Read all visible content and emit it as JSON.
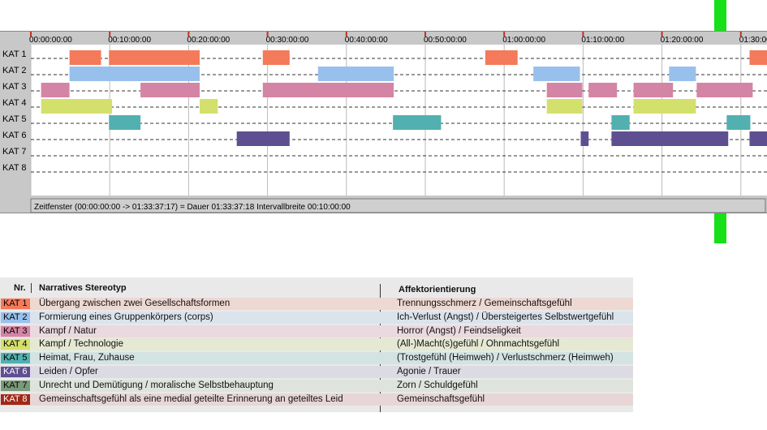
{
  "timeline": {
    "row_labels": [
      "KAT 1",
      "KAT 2",
      "KAT 3",
      "KAT 4",
      "KAT 5",
      "KAT 6",
      "KAT 7",
      "KAT 8"
    ],
    "tick_labels": [
      "00:00:00:00",
      "00:10:00:00",
      "00:20:00:00",
      "00:30:00:00",
      "00:40:00:00",
      "00:50:00:00",
      "01:00:00:00",
      "01:10:00:00",
      "01:20:00:00",
      "01:30:00"
    ],
    "status_text": "Zeitfenster (00:00:00:00 -> 01:33:37:17) = Dauer 01:33:37:18    Intervallbreite 00:10:00:00"
  },
  "chart_data": {
    "type": "timeline",
    "x_unit": "minutes",
    "xlim": [
      0,
      93.6
    ],
    "tick_interval_minutes": 10,
    "categories": [
      "KAT 1",
      "KAT 2",
      "KAT 3",
      "KAT 4",
      "KAT 5",
      "KAT 6",
      "KAT 7",
      "KAT 8"
    ],
    "colors": [
      "#f47a5a",
      "#98c0ec",
      "#d484a4",
      "#d4e06c",
      "#52b0b0",
      "#5e5090",
      "#7a9a7a",
      "#a02818"
    ],
    "segments": [
      {
        "cat": 0,
        "start": 4.9,
        "end": 8.9
      },
      {
        "cat": 0,
        "start": 9.9,
        "end": 21.4
      },
      {
        "cat": 0,
        "start": 29.4,
        "end": 32.8
      },
      {
        "cat": 0,
        "start": 57.6,
        "end": 61.7
      },
      {
        "cat": 0,
        "start": 91.1,
        "end": 93.6
      },
      {
        "cat": 1,
        "start": 4.9,
        "end": 21.4
      },
      {
        "cat": 1,
        "start": 36.4,
        "end": 46.0
      },
      {
        "cat": 1,
        "start": 63.7,
        "end": 69.6
      },
      {
        "cat": 1,
        "start": 80.9,
        "end": 84.3
      },
      {
        "cat": 2,
        "start": 1.3,
        "end": 4.9
      },
      {
        "cat": 2,
        "start": 13.9,
        "end": 21.4
      },
      {
        "cat": 2,
        "start": 29.4,
        "end": 46.0
      },
      {
        "cat": 2,
        "start": 65.4,
        "end": 69.9
      },
      {
        "cat": 2,
        "start": 70.7,
        "end": 74.3
      },
      {
        "cat": 2,
        "start": 76.4,
        "end": 81.4
      },
      {
        "cat": 2,
        "start": 84.4,
        "end": 91.5
      },
      {
        "cat": 3,
        "start": 1.3,
        "end": 10.3
      },
      {
        "cat": 3,
        "start": 21.4,
        "end": 23.7
      },
      {
        "cat": 3,
        "start": 65.4,
        "end": 69.9
      },
      {
        "cat": 3,
        "start": 76.4,
        "end": 84.3
      },
      {
        "cat": 4,
        "start": 9.9,
        "end": 13.9
      },
      {
        "cat": 4,
        "start": 45.9,
        "end": 52.0
      },
      {
        "cat": 4,
        "start": 73.6,
        "end": 75.9
      },
      {
        "cat": 4,
        "start": 88.2,
        "end": 91.2
      },
      {
        "cat": 5,
        "start": 26.1,
        "end": 32.8
      },
      {
        "cat": 5,
        "start": 69.7,
        "end": 70.7
      },
      {
        "cat": 5,
        "start": 73.6,
        "end": 88.4
      },
      {
        "cat": 5,
        "start": 91.1,
        "end": 93.6
      }
    ]
  },
  "legend": {
    "header_nr": "Nr.",
    "header_left": "Narratives Stereotyp",
    "header_right": "Affektorientierung",
    "rows": [
      {
        "code": "KAT 1",
        "left": "Übergang zwischen zwei Gesellschaftsformen",
        "right": "Trennungsschmerz / Gemeinschaftsgefühl",
        "color": "#f47a5a",
        "bg": "#eed8d2"
      },
      {
        "code": "KAT 2",
        "left": "Formierung eines Gruppenkörpers (corps)",
        "right": "Ich-Verlust (Angst) / Übersteigertes Selbstwertgefühl",
        "color": "#98c0ec",
        "bg": "#dbe3ec"
      },
      {
        "code": "KAT 3",
        "left": "Kampf / Natur",
        "right": "Horror (Angst) / Feindseligkeit",
        "color": "#d484a4",
        "bg": "#ead9df"
      },
      {
        "code": "KAT 4",
        "left": "Kampf / Technologie",
        "right": "(All-)Macht(s)gefühl / Ohnmachtsgefühl",
        "color": "#d4e06c",
        "bg": "#e5e8d2"
      },
      {
        "code": "KAT 5",
        "left": "Heimat, Frau, Zuhause",
        "right": "(Trostgefühl (Heimweh) / Verlustschmerz (Heimweh)",
        "color": "#52b0b0",
        "bg": "#d3e3e1"
      },
      {
        "code": "KAT 6",
        "left": "Leiden / Opfer",
        "right": "Agonie / Trauer",
        "color": "#5e5090",
        "bg": "#dcdbe4"
      },
      {
        "code": "KAT 7",
        "left": "Unrecht und Demütigung / moralische Selbstbehauptung",
        "right": "Zorn / Schuldgefühl",
        "color": "#7a9a7a",
        "bg": "#dee4dd"
      },
      {
        "code": "KAT 8",
        "left": "Gemeinschaftsgefühl als eine medial geteilte Erinnerung an geteiltes Leid",
        "right": "Gemeinschaftsgefühl",
        "color": "#a02818",
        "bg": "#e8d6d6"
      }
    ]
  }
}
